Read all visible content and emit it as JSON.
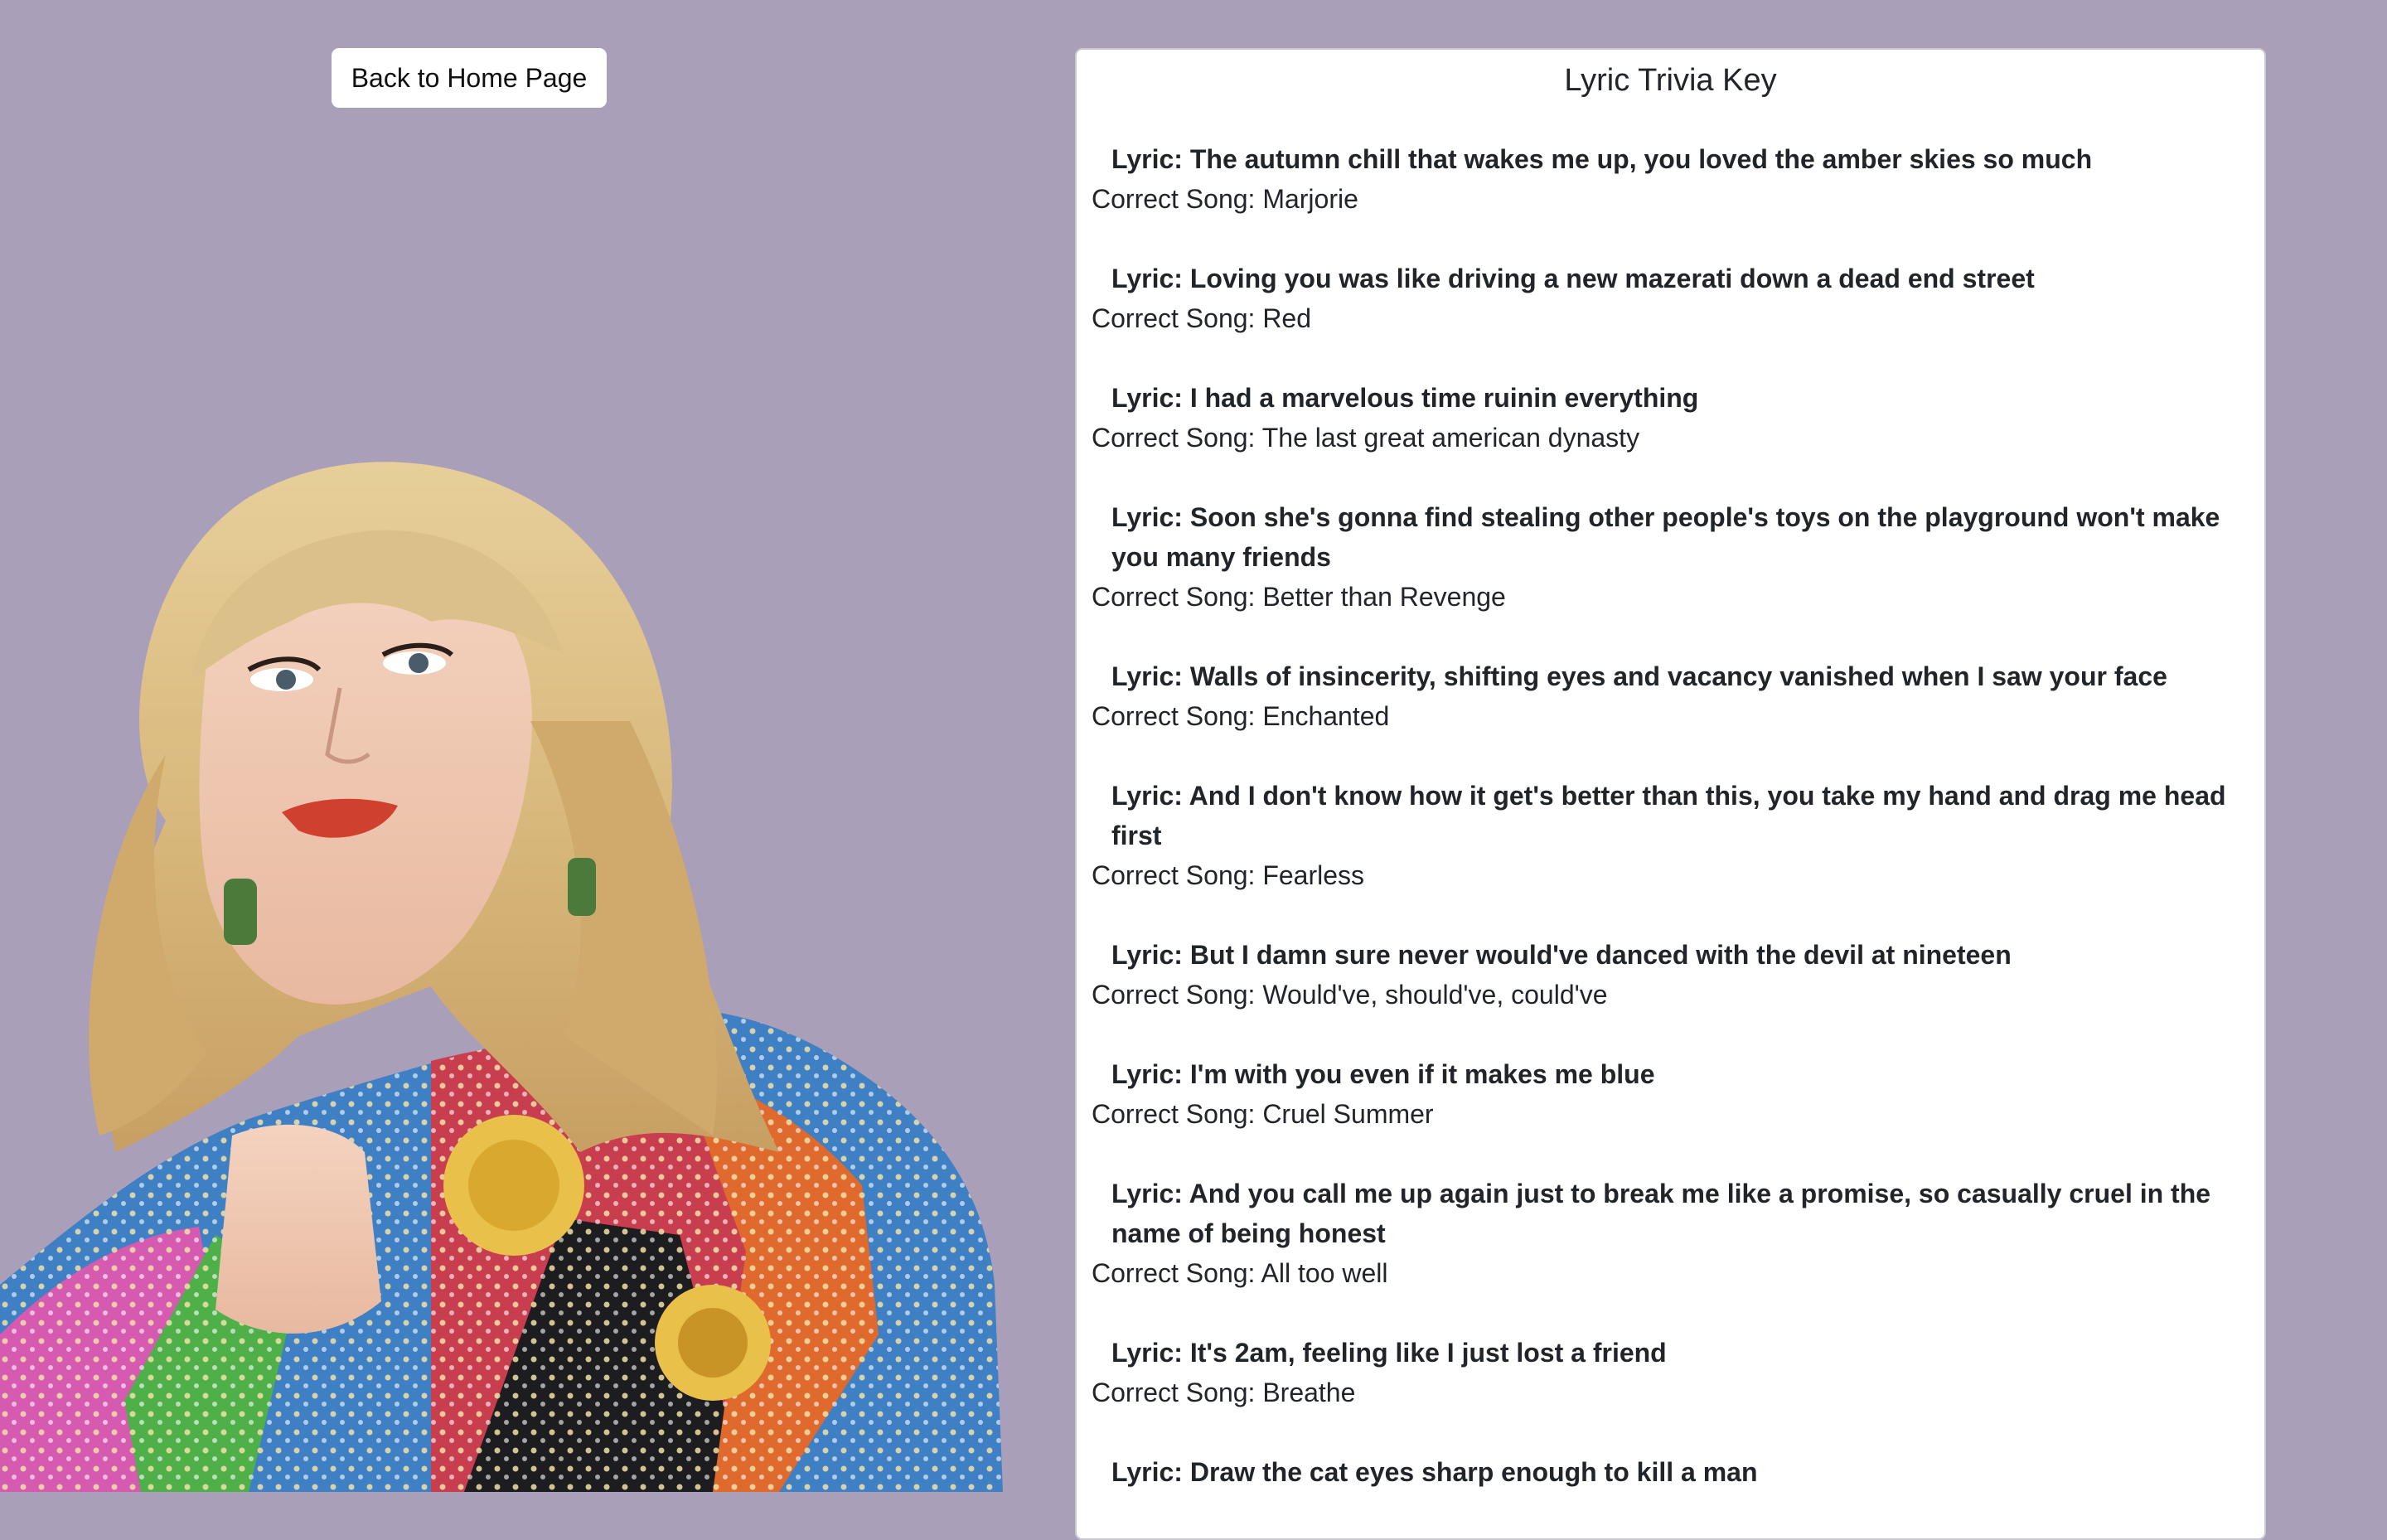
{
  "nav": {
    "back_label": "Back to Home Page"
  },
  "card": {
    "title": "Lyric Trivia Key"
  },
  "entries": [
    {
      "lyric": "Lyric: The autumn chill that wakes me up, you loved the amber skies so much",
      "song": "Correct Song: Marjorie"
    },
    {
      "lyric": "Lyric: Loving you was like driving a new mazerati down a dead end street",
      "song": "Correct Song: Red"
    },
    {
      "lyric": "Lyric: I had a marvelous time ruinin everything",
      "song": "Correct Song: The last great american dynasty"
    },
    {
      "lyric": "Lyric: Soon she's gonna find stealing other people's toys on the playground won't make you many friends",
      "song": "Correct Song: Better than Revenge"
    },
    {
      "lyric": "Lyric: Walls of insincerity, shifting eyes and vacancy vanished when I saw your face",
      "song": "Correct Song: Enchanted"
    },
    {
      "lyric": "Lyric: And I don't know how it get's better than this, you take my hand and drag me head first",
      "song": "Correct Song: Fearless"
    },
    {
      "lyric": "Lyric: But I damn sure never would've danced with the devil at nineteen",
      "song": "Correct Song: Would've, should've, could've"
    },
    {
      "lyric": "Lyric: I'm with you even if it makes me blue",
      "song": "Correct Song: Cruel Summer"
    },
    {
      "lyric": "Lyric: And you call me up again just to break me like a promise, so casually cruel in the name of being honest",
      "song": "Correct Song: All too well"
    },
    {
      "lyric": "Lyric: It's 2am, feeling like I just lost a friend",
      "song": "Correct Song: Breathe"
    },
    {
      "lyric": "Lyric: Draw the cat eyes sharp enough to kill a man",
      "song": ""
    }
  ],
  "colors": {
    "background": "#aa9fb8",
    "card": "#ffffff",
    "text": "#212529"
  },
  "icons": {
    "portrait": "portrait-photo"
  }
}
